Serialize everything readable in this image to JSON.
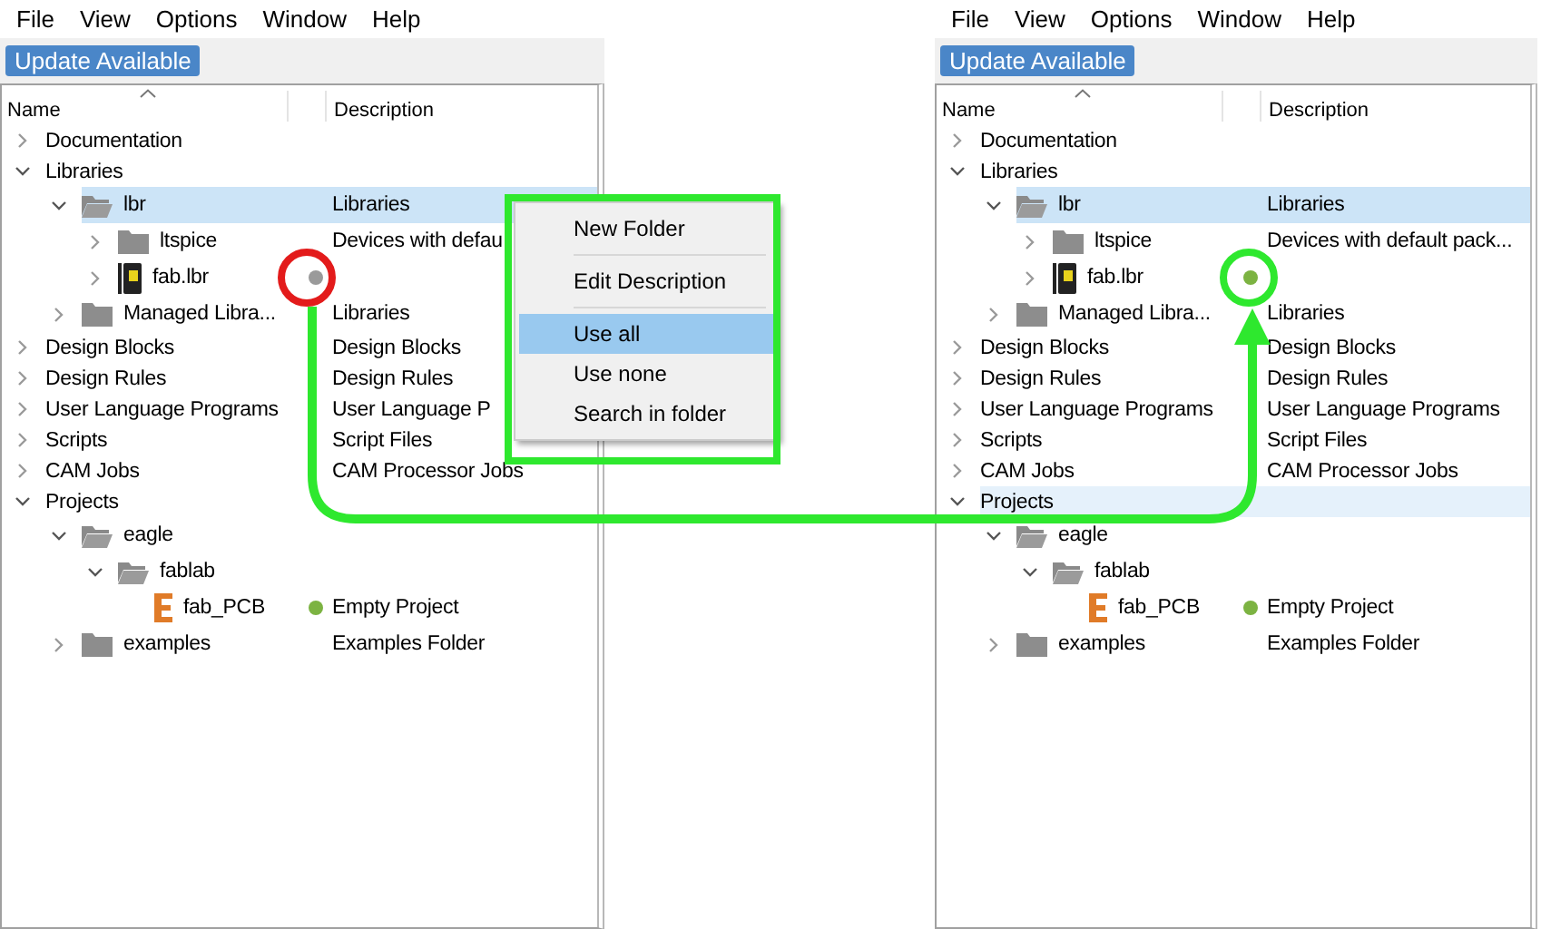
{
  "panels": [
    {
      "menu": [
        "File",
        "View",
        "Options",
        "Window",
        "Help"
      ],
      "update_button": "Update Available",
      "columns": [
        "Name",
        "Description"
      ],
      "tree": [
        {
          "name": "Documentation",
          "expanded": false,
          "kind": "none",
          "selected": false
        },
        {
          "name": "Libraries",
          "expanded": true,
          "kind": "none",
          "selected": false,
          "children": [
            {
              "name": "lbr",
              "description": "Libraries",
              "expanded": true,
              "kind": "folder",
              "selected": true,
              "children": [
                {
                  "name": "ltspice",
                  "description": "Devices with defau",
                  "expanded": false,
                  "kind": "folder",
                  "selected": false
                },
                {
                  "name": "fab.lbr",
                  "expanded": false,
                  "kind": "lbr",
                  "selected": false,
                  "in_use": false
                }
              ]
            },
            {
              "name": "Managed Libra...",
              "description": "Libraries",
              "expanded": false,
              "kind": "folder",
              "selected": false
            }
          ]
        },
        {
          "name": "Design Blocks",
          "description": "Design Blocks",
          "expanded": false,
          "kind": "none",
          "selected": false
        },
        {
          "name": "Design Rules",
          "description": "Design Rules",
          "expanded": false,
          "kind": "none",
          "selected": false
        },
        {
          "name": "User Language Programs",
          "description": "User Language P",
          "expanded": false,
          "kind": "none",
          "selected": false
        },
        {
          "name": "Scripts",
          "description": "Script Files",
          "expanded": false,
          "kind": "none",
          "selected": false
        },
        {
          "name": "CAM Jobs",
          "description": "CAM Processor Jobs",
          "expanded": false,
          "kind": "none",
          "selected": false
        },
        {
          "name": "Projects",
          "expanded": true,
          "kind": "none",
          "selected": false,
          "children": [
            {
              "name": "eagle",
              "expanded": true,
              "kind": "folder",
              "selected": false,
              "children": [
                {
                  "name": "fablab",
                  "expanded": true,
                  "kind": "folder",
                  "selected": false,
                  "children": [
                    {
                      "name": "fab_PCB",
                      "description": "Empty Project",
                      "kind": "project",
                      "selected": false,
                      "in_use": true
                    }
                  ]
                }
              ]
            },
            {
              "name": "examples",
              "description": "Examples Folder",
              "expanded": false,
              "kind": "folder",
              "selected": false
            }
          ]
        }
      ],
      "context_menu": [
        {
          "label": "New Folder",
          "selected": false
        },
        {
          "label": "Edit Description",
          "selected": false
        },
        {
          "label": "Use all",
          "selected": true
        },
        {
          "label": "Use none",
          "selected": false
        },
        {
          "label": "Search in folder",
          "selected": false
        }
      ]
    },
    {
      "menu": [
        "File",
        "View",
        "Options",
        "Window",
        "Help"
      ],
      "update_button": "Update Available",
      "columns": [
        "Name",
        "Description"
      ],
      "tree": [
        {
          "name": "Documentation",
          "expanded": false,
          "kind": "none",
          "selected": false
        },
        {
          "name": "Libraries",
          "expanded": true,
          "kind": "none",
          "selected": false,
          "children": [
            {
              "name": "lbr",
              "description": "Libraries",
              "expanded": true,
              "kind": "folder",
              "selected": true,
              "children": [
                {
                  "name": "ltspice",
                  "description": "Devices with default pack...",
                  "expanded": false,
                  "kind": "folder",
                  "selected": false
                },
                {
                  "name": "fab.lbr",
                  "expanded": false,
                  "kind": "lbr",
                  "selected": false,
                  "in_use": true
                }
              ]
            },
            {
              "name": "Managed Libra...",
              "description": "Libraries",
              "expanded": false,
              "kind": "folder",
              "selected": false
            }
          ]
        },
        {
          "name": "Design Blocks",
          "description": "Design Blocks",
          "expanded": false,
          "kind": "none",
          "selected": false
        },
        {
          "name": "Design Rules",
          "description": "Design Rules",
          "expanded": false,
          "kind": "none",
          "selected": false
        },
        {
          "name": "User Language Programs",
          "description": "User Language Programs",
          "expanded": false,
          "kind": "none",
          "selected": false
        },
        {
          "name": "Scripts",
          "description": "Script Files",
          "expanded": false,
          "kind": "none",
          "selected": false
        },
        {
          "name": "CAM Jobs",
          "description": "CAM Processor Jobs",
          "expanded": false,
          "kind": "none",
          "selected": false
        },
        {
          "name": "Projects",
          "expanded": true,
          "kind": "none",
          "selected": true,
          "children": [
            {
              "name": "eagle",
              "expanded": true,
              "kind": "folder",
              "selected": false,
              "children": [
                {
                  "name": "fablab",
                  "expanded": true,
                  "kind": "folder",
                  "selected": false,
                  "children": [
                    {
                      "name": "fab_PCB",
                      "description": "Empty Project",
                      "kind": "project",
                      "selected": false,
                      "in_use": true
                    }
                  ]
                }
              ]
            },
            {
              "name": "examples",
              "description": "Examples Folder",
              "expanded": false,
              "kind": "folder",
              "selected": false
            }
          ]
        }
      ]
    }
  ]
}
